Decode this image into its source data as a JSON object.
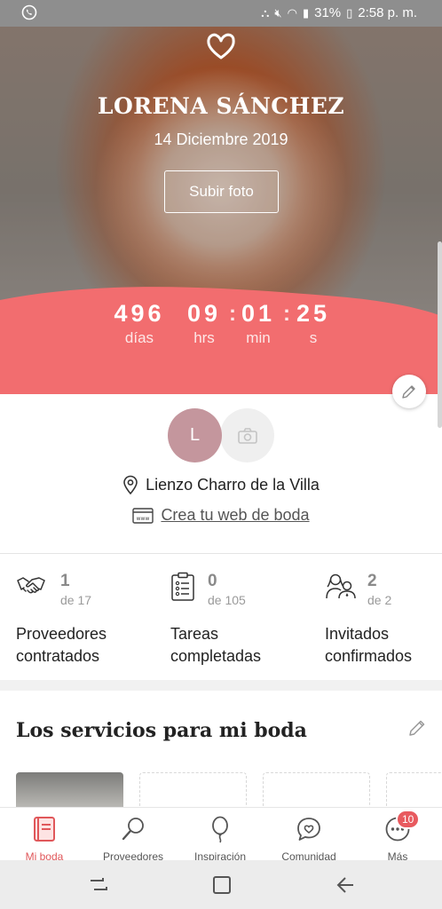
{
  "status_bar": {
    "left_icon": "whatsapp-icon",
    "battery": "31%",
    "time": "2:58 p. m."
  },
  "hero": {
    "names": "LORENA SÁNCHEZ",
    "date": "14 Diciembre 2019",
    "upload_button": "Subir foto",
    "accent_color": "#f26d6f"
  },
  "countdown": {
    "days": "496",
    "days_label": "días",
    "hours": "09",
    "hours_label": "hrs",
    "minutes": "01",
    "minutes_label": "min",
    "seconds": "25",
    "seconds_label": "s"
  },
  "profile": {
    "avatar_initial": "L",
    "venue": "Lienzo Charro de la Villa",
    "web_link": "Crea tu web de boda"
  },
  "stats": [
    {
      "count": "1",
      "of": "de 17",
      "line1": "Proveedores",
      "line2": "contratados",
      "icon": "handshake-icon"
    },
    {
      "count": "0",
      "of": "de 105",
      "line1": "Tareas",
      "line2": "completadas",
      "icon": "clipboard-icon"
    },
    {
      "count": "2",
      "of": "de 2",
      "line1": "Invitados",
      "line2": "confirmados",
      "icon": "guests-icon"
    }
  ],
  "services": {
    "title": "Los servicios para mi boda"
  },
  "bottom_nav": {
    "items": [
      {
        "label": "Mi boda",
        "icon": "notebook-icon",
        "active": true
      },
      {
        "label": "Proveedores",
        "icon": "search-icon",
        "active": false
      },
      {
        "label": "Inspiración",
        "icon": "balloon-icon",
        "active": false
      },
      {
        "label": "Comunidad",
        "icon": "chat-heart-icon",
        "active": false
      },
      {
        "label": "Más",
        "icon": "more-icon",
        "active": false
      }
    ],
    "badge": "10"
  }
}
